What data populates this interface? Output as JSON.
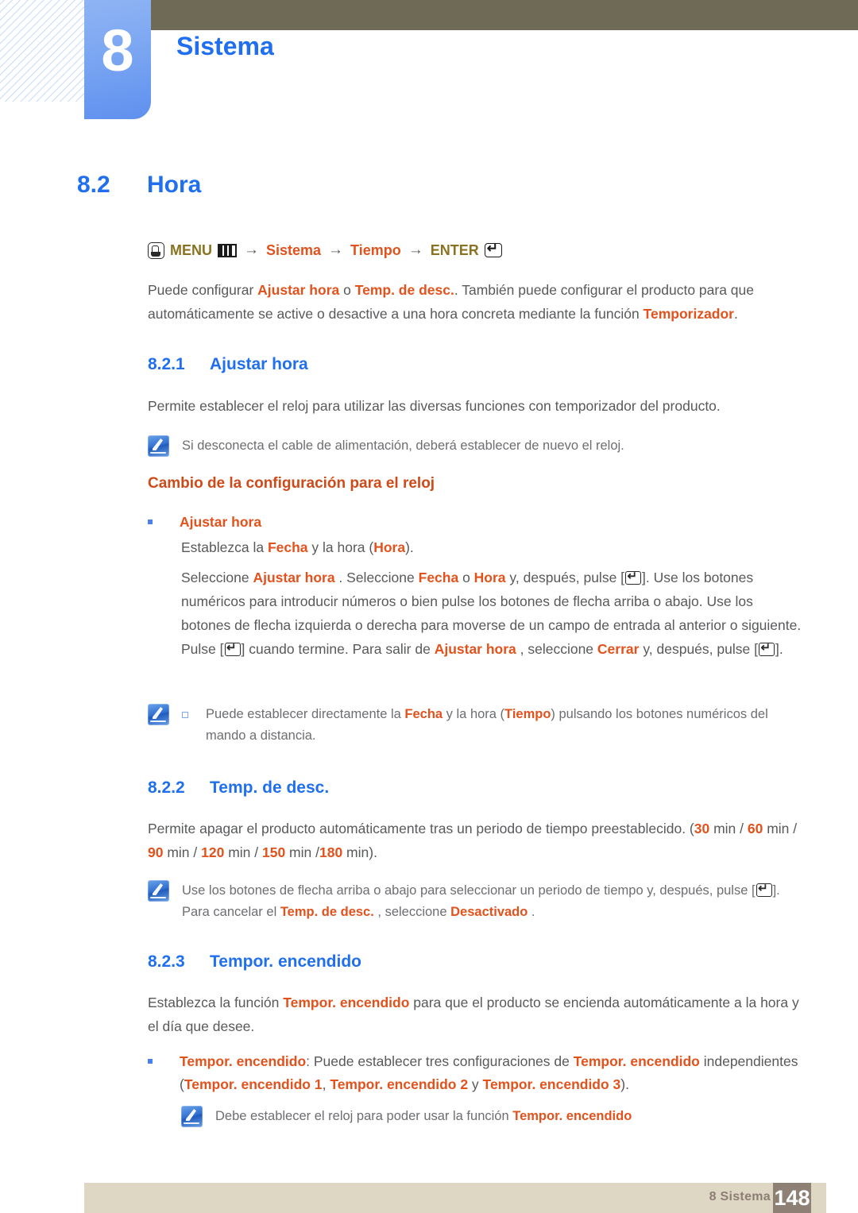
{
  "header": {
    "chapter_number": "8",
    "chapter_title": "Sistema",
    "accent_blue": "#1f6ff0",
    "olive": "#6e6a55"
  },
  "section": {
    "number": "8.2",
    "title": "Hora"
  },
  "menu_path": {
    "hand_icon": "hand-press-icon",
    "menu_label": "MENU",
    "menu_icon": "menu-bars-icon",
    "arrow": "→",
    "item1": "Sistema",
    "item2": "Tiempo",
    "enter_label": "ENTER",
    "enter_icon": "enter-key-icon",
    "gold": "#8a7320",
    "orange": "#e2521d"
  },
  "intro": {
    "t1": "Puede configurar ",
    "hl1": "Ajustar hora",
    "t2": " o ",
    "hl2": "Temp. de desc.",
    "t3": ". También puede configurar el producto para que automáticamente se active o desactive a una hora concreta mediante la función ",
    "hl3": "Temporizador",
    "t4": "."
  },
  "sub1": {
    "number": "8.2.1",
    "title": "Ajustar hora",
    "paragraph": "Permite establecer el reloj para utilizar las diversas funciones con temporizador del producto.",
    "note": "Si desconecta el cable de alimentación, deberá establecer de nuevo el reloj.",
    "subhead": "Cambio de la configuración para el reloj",
    "bullet_label": "Ajustar hora",
    "line1": {
      "t1": "Establezca la ",
      "hl1": "Fecha",
      "t2": " y la hora (",
      "hl2": "Hora",
      "t3": ")."
    },
    "line2": {
      "t1": "Seleccione ",
      "hl1": "Ajustar hora",
      "t2": " . Seleccione ",
      "hl2": "Fecha",
      "t3": " o ",
      "hl3": "Hora",
      "t4": " y, después, pulse [",
      "t5": "]. Use los botones numéricos para introducir números o bien pulse los botones de flecha arriba o abajo. Use los botones de flecha izquierda o derecha para moverse de un campo de entrada al anterior o siguiente. Pulse [",
      "t6": "] cuando termine. Para salir de ",
      "hl4": "Ajustar hora",
      "t7": " , seleccione ",
      "hl5": "Cerrar",
      "t8": " y, después, pulse [",
      "t9": "]."
    },
    "subnote": {
      "t1": "Puede establecer directamente la ",
      "hl1": "Fecha",
      "t2": " y la hora (",
      "hl2": "Tiempo",
      "t3": ") pulsando los botones numéricos del mando a distancia."
    }
  },
  "sub2": {
    "number": "8.2.2",
    "title": "Temp. de desc.",
    "paragraph": {
      "t1": "Permite apagar el producto automáticamente tras un periodo de tiempo preestablecido. (",
      "v1": "30",
      "u1": " min / ",
      "v2": "60",
      "u2": " min / ",
      "v3": "90",
      "u3": " min / ",
      "v4": "120",
      "u4": " min / ",
      "v5": "150",
      "u5": " min /",
      "v6": "180",
      "u6": " min)."
    },
    "note": {
      "t1": "Use los botones de flecha arriba o abajo para seleccionar un periodo de tiempo y, después, pulse [",
      "t2": "]. Para cancelar el ",
      "hl1": "Temp. de desc.",
      "t3": " , seleccione ",
      "hl2": "Desactivado",
      "t4": " ."
    }
  },
  "sub3": {
    "number": "8.2.3",
    "title": "Tempor. encendido",
    "paragraph": {
      "t1": "Establezca la función ",
      "hl1": "Tempor. encendido",
      "t2": " para que el producto se encienda automáticamente a la hora y el día que desee."
    },
    "bullet": {
      "hl1": "Tempor. encendido",
      "t1": ": Puede establecer tres configuraciones de ",
      "hl2": "Tempor. encendido",
      "t2": " independientes (",
      "hl3": "Tempor. encendido 1",
      "t3": ", ",
      "hl4": "Tempor. encendido 2",
      "t4": " y ",
      "hl5": "Tempor. encendido 3",
      "t5": ")."
    },
    "note": {
      "t1": "Debe establecer el reloj para poder usar la función ",
      "hl1": "Tempor. encendido"
    }
  },
  "footer": {
    "label": "8 Sistema",
    "page": "148",
    "bar_color": "#ded7c4",
    "page_block_color": "#8f8075"
  }
}
